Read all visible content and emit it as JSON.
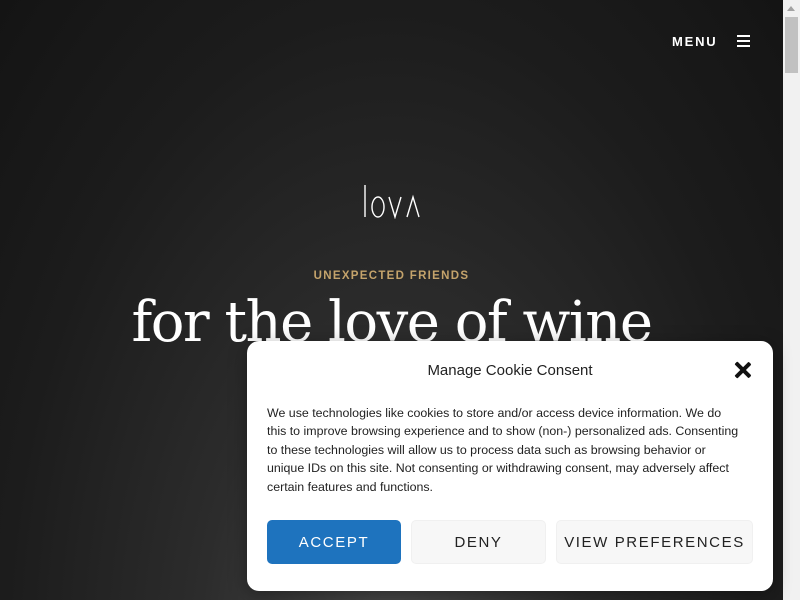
{
  "header": {
    "menu_label": "MENU",
    "menu_icon": "hamburger-icon"
  },
  "hero": {
    "logo_text": "lova",
    "eyebrow": "UNEXPECTED FRIENDS",
    "headline": "for the love of wine"
  },
  "cookie_modal": {
    "title": "Manage Cookie Consent",
    "close_icon": "close-icon",
    "body": "We use technologies like cookies to store and/or access device information. We do this to improve browsing experience and to show (non-) personalized ads. Consenting to these technologies will allow us to process data such as browsing behavior or unique IDs on this site. Not consenting or withdrawing consent, may adversely affect certain features and functions.",
    "buttons": {
      "accept": "ACCEPT",
      "deny": "DENY",
      "preferences": "VIEW PREFERENCES"
    }
  },
  "colors": {
    "accent_gold": "#c4a36b",
    "accept_blue": "#1e73be",
    "hero_dark": "#1c1c1c"
  }
}
